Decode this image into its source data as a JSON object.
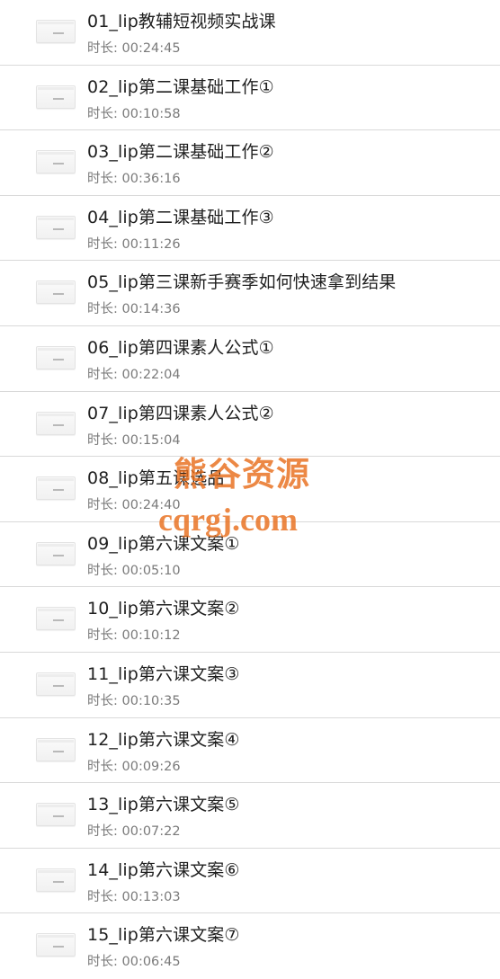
{
  "duration_label": "时长: ",
  "files": [
    {
      "name": "01_lip教辅短视频实战课",
      "duration": "00:24:45"
    },
    {
      "name": "02_lip第二课基础工作①",
      "duration": "00:10:58"
    },
    {
      "name": "03_lip第二课基础工作②",
      "duration": "00:36:16"
    },
    {
      "name": "04_lip第二课基础工作③",
      "duration": "00:11:26"
    },
    {
      "name": "05_lip第三课新手赛季如何快速拿到结果",
      "duration": "00:14:36"
    },
    {
      "name": "06_lip第四课素人公式①",
      "duration": "00:22:04"
    },
    {
      "name": "07_lip第四课素人公式②",
      "duration": "00:15:04"
    },
    {
      "name": "08_lip第五课选品",
      "duration": "00:24:40"
    },
    {
      "name": "09_lip第六课文案①",
      "duration": "00:05:10"
    },
    {
      "name": "10_lip第六课文案②",
      "duration": "00:10:12"
    },
    {
      "name": "11_lip第六课文案③",
      "duration": "00:10:35"
    },
    {
      "name": "12_lip第六课文案④",
      "duration": "00:09:26"
    },
    {
      "name": "13_lip第六课文案⑤",
      "duration": "00:07:22"
    },
    {
      "name": "14_lip第六课文案⑥",
      "duration": "00:13:03"
    },
    {
      "name": "15_lip第六课文案⑦",
      "duration": "00:06:45"
    }
  ],
  "watermark": {
    "brand": "熊谷资源",
    "domain": "cqrgj.com",
    "color": "#e86e1c"
  },
  "icons": {
    "file_thumbnail": "video-file-icon"
  }
}
